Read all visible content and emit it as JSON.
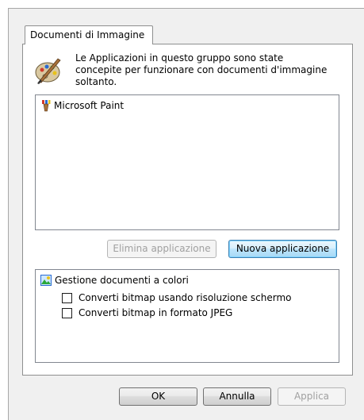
{
  "tab": {
    "label": "Documenti di Immagine"
  },
  "description": {
    "line1": "Le Applicazioni in questo gruppo sono state",
    "line2": "concepite per funzionare con documenti d'immagine",
    "line3": "soltanto."
  },
  "app_list": {
    "items": [
      {
        "label": "Microsoft Paint",
        "icon": "paint-brush-icon"
      }
    ]
  },
  "buttons": {
    "remove_app": "Elimina applicazione",
    "new_app": "Nuova applicazione",
    "ok": "OK",
    "cancel": "Annulla",
    "apply": "Applica"
  },
  "color_docs": {
    "title": "Gestione documenti a colori",
    "icon": "color-image-icon",
    "options": [
      {
        "label": "Converti bitmap usando risoluzione schermo",
        "checked": false
      },
      {
        "label": "Converti bitmap in formato JPEG",
        "checked": false
      }
    ]
  }
}
